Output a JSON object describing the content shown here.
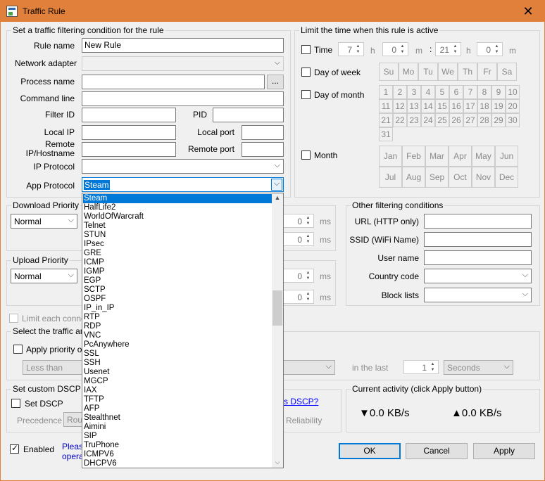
{
  "window": {
    "title": "Traffic Rule",
    "close": "✕"
  },
  "cond": {
    "group_title": "Set a traffic filtering condition for the rule",
    "rule_name_label": "Rule name",
    "rule_name_value": "New Rule",
    "adapter_label": "Network adapter",
    "process_label": "Process name",
    "browse_label": "...",
    "cmd_label": "Command line",
    "filter_id_label": "Filter ID",
    "pid_label": "PID",
    "local_ip_label": "Local IP",
    "local_port_label": "Local port",
    "remote_ip_label": "Remote IP/Hostname",
    "remote_port_label": "Remote port",
    "ip_proto_label": "IP Protocol",
    "app_proto_label": "App Protocol",
    "app_proto_value": "Steam"
  },
  "time": {
    "group_title": "Limit the time when this rule is active",
    "time_label": "Time",
    "h1": "7",
    "h_unit": "h",
    "m1": "0",
    "m_unit": "m",
    "colon": ":",
    "h2": "21",
    "m2": "0",
    "dow_label": "Day of week",
    "days": [
      "Su",
      "Mo",
      "Tu",
      "We",
      "Th",
      "Fr",
      "Sa"
    ],
    "dom_label": "Day of month",
    "month_days": [
      "1",
      "2",
      "3",
      "4",
      "5",
      "6",
      "7",
      "8",
      "9",
      "10",
      "11",
      "12",
      "13",
      "14",
      "15",
      "16",
      "17",
      "18",
      "19",
      "20",
      "21",
      "22",
      "23",
      "24",
      "25",
      "26",
      "27",
      "28",
      "29",
      "30",
      "31"
    ],
    "month_label": "Month",
    "months": [
      "Jan",
      "Feb",
      "Mar",
      "Apr",
      "May",
      "Jun",
      "Jul",
      "Aug",
      "Sep",
      "Oct",
      "Nov",
      "Dec"
    ]
  },
  "download": {
    "title": "Download Priority",
    "value": "Normal",
    "v1": "0",
    "v2": "0",
    "unit": "ms"
  },
  "upload": {
    "title": "Upload Priority",
    "value": "Normal",
    "v1": "0",
    "v2": "0",
    "unit": "ms"
  },
  "limit_each": "Limit each connection",
  "amount": {
    "title": "Select the traffic amount",
    "apply_priority": "Apply priority only",
    "less_than": "Less than",
    "in_the_last": "in the last",
    "last_value": "1",
    "period": "Seconds"
  },
  "other": {
    "title": "Other filtering conditions",
    "url_label": "URL (HTTP only)",
    "ssid_label": "SSID (WiFi Name)",
    "user_label": "User name",
    "country_label": "Country code",
    "block_label": "Block lists"
  },
  "dscp": {
    "title": "Set custom DSCP flags",
    "set_label": "Set DSCP",
    "precedence": "Precedence",
    "precedence_value": "Rou",
    "reliability": "Reliability",
    "link": "s DSCP?"
  },
  "activity": {
    "title": "Current activity (click Apply button)",
    "down": "▼0.0 KB/s",
    "up": "▲0.0 KB/s"
  },
  "enabled_label": "Enabled",
  "note": {
    "line1": "Please",
    "line2": "operat"
  },
  "buttons": {
    "ok": "OK",
    "cancel": "Cancel",
    "apply": "Apply"
  },
  "protocols": [
    "Steam",
    "HalfLife2",
    "WorldOfWarcraft",
    "Telnet",
    "STUN",
    "IPsec",
    "GRE",
    "ICMP",
    "IGMP",
    "EGP",
    "SCTP",
    "OSPF",
    "IP_in_IP",
    "RTP",
    "RDP",
    "VNC",
    "PcAnywhere",
    "SSL",
    "SSH",
    "Usenet",
    "MGCP",
    "IAX",
    "TFTP",
    "AFP",
    "Stealthnet",
    "Aimini",
    "SIP",
    "TruPhone",
    "ICMPV6",
    "DHCPV6"
  ]
}
